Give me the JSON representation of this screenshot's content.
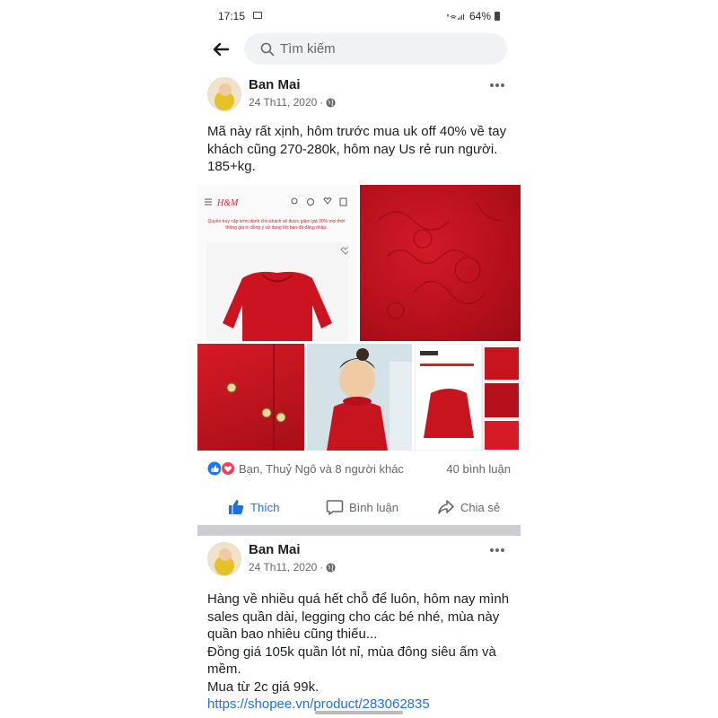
{
  "status_bar": {
    "time": "17:15",
    "battery": "64%"
  },
  "search": {
    "placeholder": "Tìm kiếm"
  },
  "posts": [
    {
      "author": "Ban Mai",
      "date": "24 Th11, 2020",
      "separator": "·",
      "text_lines": [
        "Mã này rất xịnh, hôm trước mua uk off 40% về tay",
        "khách cũng 270-280k, hôm nay Us rẻ run người.",
        "185+kg."
      ],
      "reactions_text": "Bạn, Thuỷ Ngô và 8 người khác",
      "comments": "40 bình luận",
      "actions": {
        "like": "Thích",
        "comment": "Bình luận",
        "share": "Chia sẻ"
      },
      "images": {
        "hm_logo": "H&M",
        "hm_promo": "Quyền truy cập sớm dành cho khách sẽ được giảm giá 30% mọi thời thông giá trị đồng ý sử dụng khi bạn đã đăng nhập."
      }
    },
    {
      "author": "Ban Mai",
      "date": "24 Th11, 2020",
      "separator": "·",
      "text_lines": [
        "Hàng về nhiều quá hết chỗ để luôn, hôm nay mình",
        "sales quần dài, legging cho các bé nhé, mùa này",
        "quần bao nhiêu cũng thiếu...",
        "Đồng giá 105k quần lót nỉ, mùa đông siêu ấm và",
        "mềm.",
        "Mua từ 2c giá 99k."
      ],
      "link": "https://shopee.vn/product/283062835"
    }
  ],
  "colors": {
    "accent": "#216fdb",
    "text": "#1c1e21",
    "secondary": "#65676b",
    "search_bg": "#f0f2f5",
    "divider": "#c9ccd1"
  }
}
